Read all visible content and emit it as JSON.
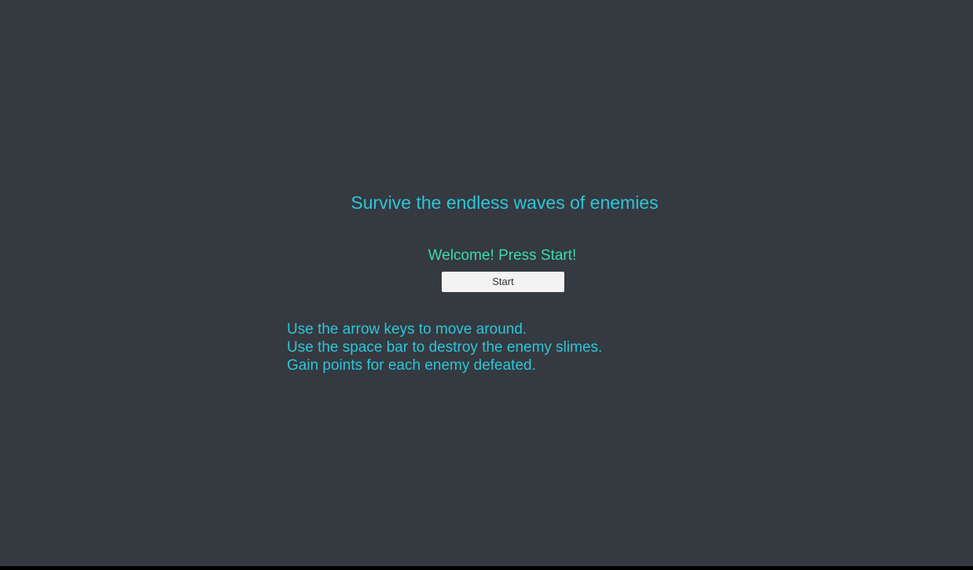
{
  "menu": {
    "title": "Survive the endless waves of enemies",
    "status": "Welcome! Press Start!",
    "start_label": "Start",
    "instructions": [
      "Use the arrow keys to move around.",
      "Use the space bar to destroy the enemy slimes.",
      "Gain points for each enemy defeated."
    ]
  },
  "colors": {
    "background": "#353940",
    "title_text": "#2cc6d8",
    "status_text": "#37dbb4",
    "button_bg": "#f3f3f3",
    "button_text": "#333333"
  }
}
